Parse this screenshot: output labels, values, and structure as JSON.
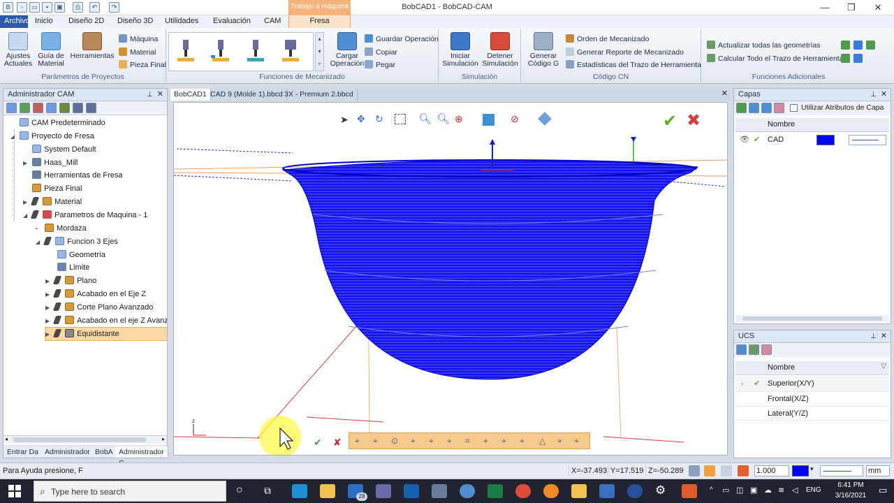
{
  "window": {
    "title": "BobCAD1 - BobCAD-CAM",
    "context_band": "Trabajo a máquina",
    "minimize": "—",
    "maximize": "❐",
    "close": "✕"
  },
  "ribbon_tabs": [
    "Archivo",
    "Inicio",
    "Diseño 2D",
    "Diseño 3D",
    "Utilidades",
    "Evaluación",
    "CAM",
    "Fresa"
  ],
  "ribbon": {
    "parametros": {
      "label": "Parámetros de Proyectos",
      "ajustes": "Ajustes\nActuales",
      "guia": "Guía de\nMaterial",
      "herramientas": "Herramientas",
      "maquina": "Máquina",
      "material": "Material",
      "pieza_final": "Pieza Final"
    },
    "funciones": {
      "label": "Funciones de Mecanizado",
      "cargar": "Cargar\nOperación",
      "guardar": "Guardar Operación",
      "copiar": "Copiar",
      "pegar": "Pegar"
    },
    "simulacion": {
      "label": "Simulación",
      "iniciar": "Iniciar\nSimulación",
      "detener": "Detener\nSimulación"
    },
    "codigo": {
      "label": "Código CN",
      "generar": "Generar\nCódigo G",
      "orden": "Orden de Mecanizado",
      "reporte": "Generar Reporte de Mecanizado",
      "estadisticas": "Estadísticas del Trazo de Herramienta"
    },
    "adicionales": {
      "label": "Funciones Adicionales",
      "actualizar": "Actualizar todas las geometrías",
      "calcular": "Calcular Todo el Trazo de Herramienta"
    }
  },
  "cam_manager": {
    "title": "Administrador CAM",
    "items": [
      {
        "label": "CAM Predeterminado"
      },
      {
        "label": "Proyecto de Fresa"
      },
      {
        "label": "System Default"
      },
      {
        "label": "Haas_Mill"
      },
      {
        "label": "Herramientas de Fresa"
      },
      {
        "label": "Pieza Final"
      },
      {
        "label": "Material"
      },
      {
        "label": "Parametros de Maquina - 1"
      },
      {
        "label": "Mordaza"
      },
      {
        "label": "Funcion 3 Ejes"
      },
      {
        "label": "Geometría"
      },
      {
        "label": "Limite"
      },
      {
        "label": "Plano"
      },
      {
        "label": "Acabado en el Eje Z"
      },
      {
        "label": "Corte Plano Avanzado"
      },
      {
        "label": "Acabado en el eje Z Avanzad"
      },
      {
        "label": "Equidistante"
      }
    ],
    "bottom_tabs": [
      "Entrar Da",
      "Administrador",
      "BobA",
      "Administrador C"
    ]
  },
  "doc_tabs": [
    "BobCAD1",
    "CAD 9 (Molde 1).bbcd",
    "3X - Premium 2.bbcd"
  ],
  "layers": {
    "title": "Capas",
    "use_layer_attrs": "Utilizar Atributos de Capa",
    "col_name": "Nombre",
    "rows": [
      {
        "name": "CAD",
        "color": "#0000ff"
      }
    ]
  },
  "ucs": {
    "title": "UCS",
    "col_name": "Nombre",
    "rows": [
      {
        "name": "Superior(X/Y)"
      },
      {
        "name": "Frontal(X/Z)"
      },
      {
        "name": "Lateral(Y/Z)"
      }
    ]
  },
  "status": {
    "help": "Para Ayuda presione, F",
    "x": "X=-37.493",
    "y": "Y=17.519",
    "z": "Z=-50.289",
    "line_width": "1.000",
    "units": "mm"
  },
  "taskbar": {
    "search_placeholder": "Type here to search",
    "mail_badge": "28",
    "language": "ENG",
    "time": "6:41 PM",
    "date": "3/16/2021"
  },
  "colors": {
    "accent": "#2d5aa8",
    "toolpath": "#1010e0",
    "context": "#f5b27a"
  }
}
